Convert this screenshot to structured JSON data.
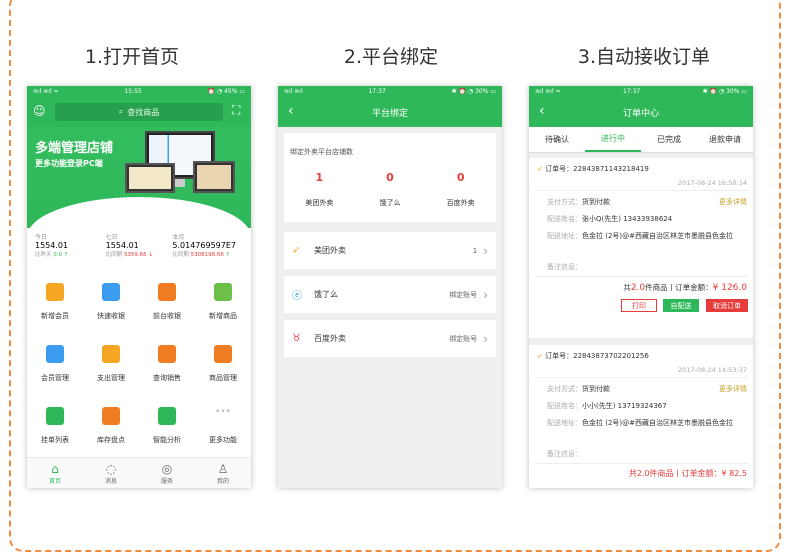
{
  "captions": [
    "1.打开首页",
    "2.平台绑定",
    "3.自动接收订单"
  ],
  "p1": {
    "status": {
      "left": "≋ıl ≋ıl ≈",
      "time": "15:55",
      "right": "⏰ ◔ 45% ▭"
    },
    "search_placeholder": "查找商品",
    "banner_title": "多端管理店铺",
    "banner_sub": "更多功能登录PC端",
    "stats": [
      {
        "label": "今日",
        "value": "1554.01",
        "sub_label": "比昨天",
        "sub_value": "0.0",
        "arrow": "↑"
      },
      {
        "label": "七日",
        "value": "1554.01",
        "sub_label": "比同期",
        "sub_value": "5359.66",
        "arrow": "↓"
      },
      {
        "label": "本月",
        "value": "5.014769597E7",
        "sub_label": "比同期",
        "sub_value": "5308198.66",
        "arrow": "↑"
      }
    ],
    "grid": [
      {
        "label": "新增会员",
        "icon": "add-member-icon",
        "color": "#f5a623"
      },
      {
        "label": "快速收银",
        "icon": "scan-icon",
        "color": "#3c9cf0"
      },
      {
        "label": "前台收银",
        "icon": "cashier-icon",
        "color": "#f07d22"
      },
      {
        "label": "新增商品",
        "icon": "add-product-icon",
        "color": "#6cc04a"
      },
      {
        "label": "会员管理",
        "icon": "member-icon",
        "color": "#3c9cf0"
      },
      {
        "label": "支出管理",
        "icon": "expense-icon",
        "color": "#f5a623"
      },
      {
        "label": "查询销售",
        "icon": "sales-query-icon",
        "color": "#f07d22"
      },
      {
        "label": "商品管理",
        "icon": "product-manage-icon",
        "color": "#f07d22"
      },
      {
        "label": "挂单列表",
        "icon": "list-icon",
        "color": "#2fb85a"
      },
      {
        "label": "库存盘点",
        "icon": "stock-icon",
        "color": "#f07d22"
      },
      {
        "label": "智能分析",
        "icon": "chart-icon",
        "color": "#2fb85a"
      },
      {
        "label": "更多功能",
        "icon": "more-icon",
        "color": "#aaa"
      }
    ],
    "tabs": [
      {
        "label": "首页",
        "icon": "home-icon",
        "glyph": "⌂"
      },
      {
        "label": "消息",
        "icon": "message-icon",
        "glyph": "◌"
      },
      {
        "label": "服务",
        "icon": "compass-icon",
        "glyph": "◎"
      },
      {
        "label": "我的",
        "icon": "user-icon",
        "glyph": "♙"
      }
    ]
  },
  "p2": {
    "status": {
      "left": "≋ıl ≋ıl",
      "time": "17:37",
      "right": "✱ ⏰ ◔ 30% ▭"
    },
    "title": "平台绑定",
    "count_title": "绑定外卖平台店铺数",
    "counts": [
      {
        "value": "1",
        "label": "美团外卖"
      },
      {
        "value": "0",
        "label": "饿了么"
      },
      {
        "value": "0",
        "label": "百度外卖"
      }
    ],
    "rows": [
      {
        "name": "美团外卖",
        "right": "1",
        "icon": "meituan-icon",
        "glyph": "➶",
        "color": "#f5a623"
      },
      {
        "name": "饿了么",
        "right": "绑定账号",
        "icon": "eleme-icon",
        "glyph": "ⓔ",
        "color": "#2d9cdb"
      },
      {
        "name": "百度外卖",
        "right": "绑定账号",
        "icon": "baidu-icon",
        "glyph": "♉",
        "color": "#e73c3c"
      }
    ]
  },
  "p3": {
    "status": {
      "left": "≋ıl ≋ıl ≈",
      "time": "17:37",
      "right": "✱ ⏰ ◔ 30% ▭"
    },
    "title": "订单中心",
    "tabs": [
      "待确认",
      "进行中",
      "已完成",
      "退款申请"
    ],
    "order1": {
      "no": "订单号：22843871143218419",
      "time": "2017-08-24 16:50:14",
      "pay_label": "支付方式：",
      "pay": "货到付款",
      "more": "更多详情",
      "name_label": "配送姓名：",
      "name": "张小Q(先生)  13433938624",
      "addr_label": "配送地址：",
      "addr": "色金拉 (2号)@#西藏自治区林芝市墨脱县色金拉",
      "note_label": "备注信息：",
      "sum_a": "共",
      "sum_count": "2.0",
      "sum_b": "件商品丨订单金额：",
      "sum_amount": "¥ 126.0",
      "btn_print": "打印",
      "btn_self": "自配送",
      "btn_cancel": "取消订单"
    },
    "order2": {
      "no": "订单号：22843873702201256",
      "time": "2017-08-24 14:53:37",
      "pay_label": "支付方式：",
      "pay": "货到付款",
      "more": "更多详情",
      "name_label": "配送姓名：",
      "name": "小小(先生)  13719324367",
      "addr_label": "配送地址：",
      "addr": "色金拉 (2号)@#西藏自治区林芝市墨脱县色金拉",
      "note_label": "备注信息：",
      "sum_partial": "共2.0件商品丨订单金额：¥ 82.5"
    }
  }
}
